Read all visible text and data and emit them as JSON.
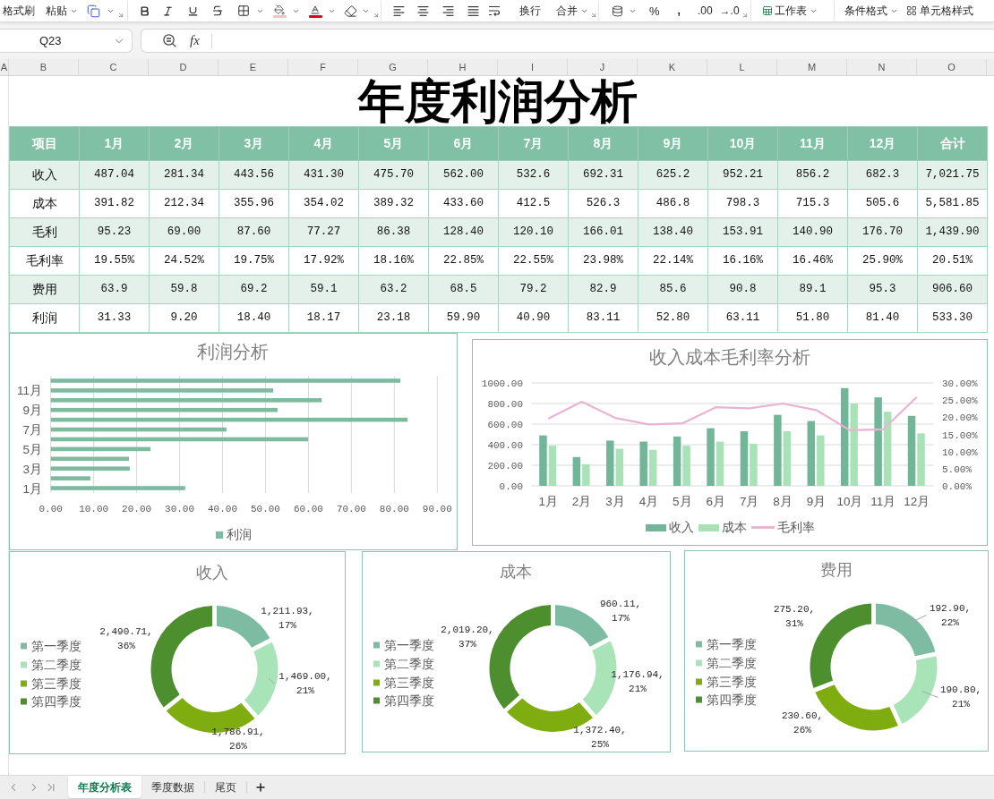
{
  "ribbon": {
    "clipboard": [
      "格式刷",
      "粘贴"
    ],
    "alignment": [
      "换行",
      "合并"
    ],
    "number_format": [
      "%",
      ",",
      ".00",
      "→.0"
    ],
    "worksheet": "工作表",
    "styles": [
      "条件格式",
      "单元格样式"
    ]
  },
  "name_box": {
    "value": "Q23"
  },
  "formula_bar": {
    "function_label": "fx"
  },
  "column_headers": [
    "A",
    "B",
    "C",
    "D",
    "E",
    "F",
    "G",
    "H",
    "I",
    "J",
    "K",
    "L",
    "M",
    "N",
    "O"
  ],
  "title": "年度利润分析",
  "table": {
    "columns": [
      "项目",
      "1月",
      "2月",
      "3月",
      "4月",
      "5月",
      "6月",
      "7月",
      "8月",
      "9月",
      "10月",
      "11月",
      "12月",
      "合计"
    ],
    "rows": [
      [
        "收入",
        "487.04",
        "281.34",
        "443.56",
        "431.30",
        "475.70",
        "562.00",
        "532.6",
        "692.31",
        "625.2",
        "952.21",
        "856.2",
        "682.3",
        "7,021.75"
      ],
      [
        "成本",
        "391.82",
        "212.34",
        "355.96",
        "354.02",
        "389.32",
        "433.60",
        "412.5",
        "526.3",
        "486.8",
        "798.3",
        "715.3",
        "505.6",
        "5,581.85"
      ],
      [
        "毛利",
        "95.23",
        "69.00",
        "87.60",
        "77.27",
        "86.38",
        "128.40",
        "120.10",
        "166.01",
        "138.40",
        "153.91",
        "140.90",
        "176.70",
        "1,439.90"
      ],
      [
        "毛利率",
        "19.55%",
        "24.52%",
        "19.75%",
        "17.92%",
        "18.16%",
        "22.85%",
        "22.55%",
        "23.98%",
        "22.14%",
        "16.16%",
        "16.46%",
        "25.90%",
        "20.51%"
      ],
      [
        "费用",
        "63.9",
        "59.8",
        "69.2",
        "59.1",
        "63.2",
        "68.5",
        "79.2",
        "82.9",
        "85.6",
        "90.8",
        "89.1",
        "95.3",
        "906.60"
      ],
      [
        "利润",
        "31.33",
        "9.20",
        "18.40",
        "18.17",
        "23.18",
        "59.90",
        "40.90",
        "83.11",
        "52.80",
        "63.11",
        "51.80",
        "81.40",
        "533.30"
      ]
    ]
  },
  "profit_chart": {
    "chart_data": {
      "type": "bar",
      "orientation": "horizontal",
      "title": "利润分析",
      "x": [
        1,
        2,
        3,
        4,
        5,
        6,
        7,
        8,
        9,
        10,
        11,
        12
      ],
      "series": [
        {
          "name": "利润",
          "color": "#7dba9f",
          "values": [
            31.3,
            9.2,
            18.4,
            18.2,
            23.2,
            59.9,
            40.9,
            83.1,
            52.8,
            63.1,
            51.8,
            81.4
          ]
        }
      ],
      "xlim": [
        0,
        90
      ],
      "xticks": [
        {
          "value": 0,
          "label": "0.00"
        },
        {
          "value": 10,
          "label": "10.00"
        },
        {
          "value": 20,
          "label": "20.00"
        },
        {
          "value": 30,
          "label": "30.00"
        },
        {
          "value": 40,
          "label": "40.00"
        },
        {
          "value": 50,
          "label": "50.00"
        },
        {
          "value": 60,
          "label": "60.00"
        },
        {
          "value": 70,
          "label": "70.00"
        },
        {
          "value": 80,
          "label": "80.00"
        },
        {
          "value": 90,
          "label": "90.00"
        }
      ],
      "ylim": [
        0.5,
        12.5
      ],
      "yticks": [
        {
          "value": 1,
          "label": "1月"
        },
        {
          "value": 3,
          "label": "3月"
        },
        {
          "value": 5,
          "label": "5月"
        },
        {
          "value": 7,
          "label": "7月"
        },
        {
          "value": 9,
          "label": "9月"
        },
        {
          "value": 11,
          "label": "11月"
        }
      ],
      "grid": true,
      "legend": "bottom"
    }
  },
  "combo_chart": {
    "chart_data": {
      "type": "bar",
      "title": "收入成本毛利率分析",
      "categories": [
        "1月",
        "2月",
        "3月",
        "4月",
        "5月",
        "6月",
        "7月",
        "8月",
        "9月",
        "10月",
        "11月",
        "12月"
      ],
      "series": [
        {
          "name": "收入",
          "color": "#72b699",
          "values": [
            490,
            280,
            440,
            430,
            480,
            560,
            530,
            690,
            630,
            950,
            860,
            680
          ]
        },
        {
          "name": "成本",
          "color": "#a9e2b6",
          "values": [
            390,
            210,
            360,
            350,
            390,
            430,
            410,
            530,
            490,
            800,
            720,
            510
          ]
        },
        {
          "name": "毛利率",
          "type": "line",
          "axis": "y2",
          "color": "#e8b4cf",
          "values": [
            0.196,
            0.245,
            0.198,
            0.179,
            0.182,
            0.229,
            0.226,
            0.24,
            0.221,
            0.162,
            0.165,
            0.259
          ]
        }
      ],
      "ylim": [
        0,
        1000
      ],
      "yticks": [
        {
          "value": 0,
          "label": "0.00"
        },
        {
          "value": 200,
          "label": "200.00"
        },
        {
          "value": 400,
          "label": "400.00"
        },
        {
          "value": 600,
          "label": "600.00"
        },
        {
          "value": 800,
          "label": "800.00"
        },
        {
          "value": 1000,
          "label": "1000.00"
        }
      ],
      "y2lim": [
        0,
        0.3
      ],
      "y2ticks": [
        {
          "value": 0,
          "label": "0.00%"
        },
        {
          "value": 0.05,
          "label": "5.00%"
        },
        {
          "value": 0.1,
          "label": "10.00%"
        },
        {
          "value": 0.15,
          "label": "15.00%"
        },
        {
          "value": 0.2,
          "label": "20.00%"
        },
        {
          "value": 0.25,
          "label": "25.00%"
        },
        {
          "value": 0.3,
          "label": "30.00%"
        }
      ],
      "grid": true,
      "legend": "bottom"
    }
  },
  "quarter_charts": [
    {
      "chart_data": {
        "type": "donut",
        "title": "收入",
        "categories": [
          "第一季度",
          "第二季度",
          "第三季度",
          "第四季度"
        ],
        "colors": [
          "#7dbba3",
          "#a8e4b8",
          "#7fad10",
          "#4d8e2f"
        ],
        "values": [
          1211.93,
          1469.0,
          1786.91,
          2490.71
        ],
        "value_labels": [
          "1,211.93, 17%",
          "1,469.00, 21%",
          "1,786.91, 26%",
          "2,490.71, 36%"
        ],
        "legend": "left"
      }
    },
    {
      "chart_data": {
        "type": "donut",
        "title": "成本",
        "categories": [
          "第一季度",
          "第二季度",
          "第三季度",
          "第四季度"
        ],
        "colors": [
          "#7dbba3",
          "#a8e4b8",
          "#7fad10",
          "#4d8e2f"
        ],
        "values": [
          960.11,
          1176.94,
          1372.4,
          2019.2
        ],
        "value_labels": [
          "960.11, 17%",
          "1,176.94, 21%",
          "1,372.40, 25%",
          "2,019.20, 37%"
        ],
        "legend": "left"
      }
    },
    {
      "chart_data": {
        "type": "donut",
        "title": "费用",
        "categories": [
          "第一季度",
          "第二季度",
          "第三季度",
          "第四季度"
        ],
        "colors": [
          "#7dbba3",
          "#a8e4b8",
          "#7fad10",
          "#4d8e2f"
        ],
        "values": [
          192.9,
          190.8,
          230.6,
          275.2
        ],
        "value_labels": [
          "192.90, 22%",
          "190.80, 21%",
          "230.60, 26%",
          "275.20, 31%"
        ],
        "legend": "left"
      }
    }
  ],
  "sheet_tabs": [
    {
      "label": "年度分析表",
      "selected": true
    },
    {
      "label": "季度数据",
      "selected": false
    },
    {
      "label": "尾页",
      "selected": false
    }
  ]
}
